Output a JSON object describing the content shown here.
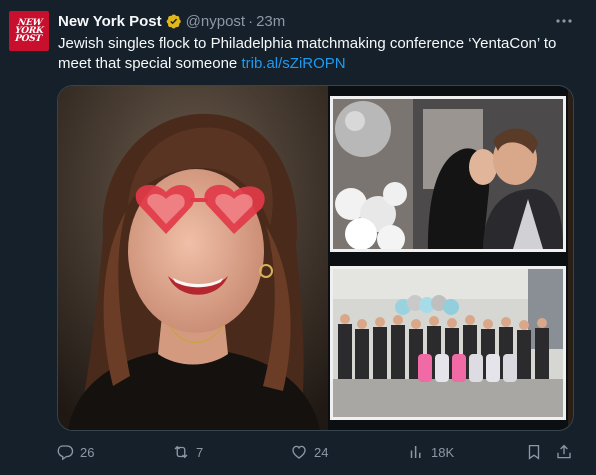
{
  "tweet": {
    "avatar_text": "NEW\nYORK\nPOST",
    "author": "New York Post",
    "handle": "@nypost",
    "separator": "·",
    "time": "23m",
    "text": "Jewish singles flock to Philadelphia matchmaking conference ‘YentaCon’ to meet that special someone",
    "link": "trib.al/sZiROPN",
    "more_icon": "more-horizontal-icon",
    "verified_icon": "verified-gold-badge-icon"
  },
  "colors": {
    "background": "#15202b",
    "link": "#1d9bf0",
    "muted": "#8b98a5",
    "brand": "#c8102e",
    "verified": "#e2b719"
  },
  "actions": {
    "replies": {
      "icon": "reply-icon",
      "count": "26"
    },
    "reposts": {
      "icon": "repost-icon",
      "count": "7"
    },
    "likes": {
      "icon": "heart-icon",
      "count": "24"
    },
    "views": {
      "icon": "views-chart-icon",
      "count": "18K"
    },
    "bookmark": {
      "icon": "bookmark-icon"
    },
    "share": {
      "icon": "share-icon"
    }
  }
}
